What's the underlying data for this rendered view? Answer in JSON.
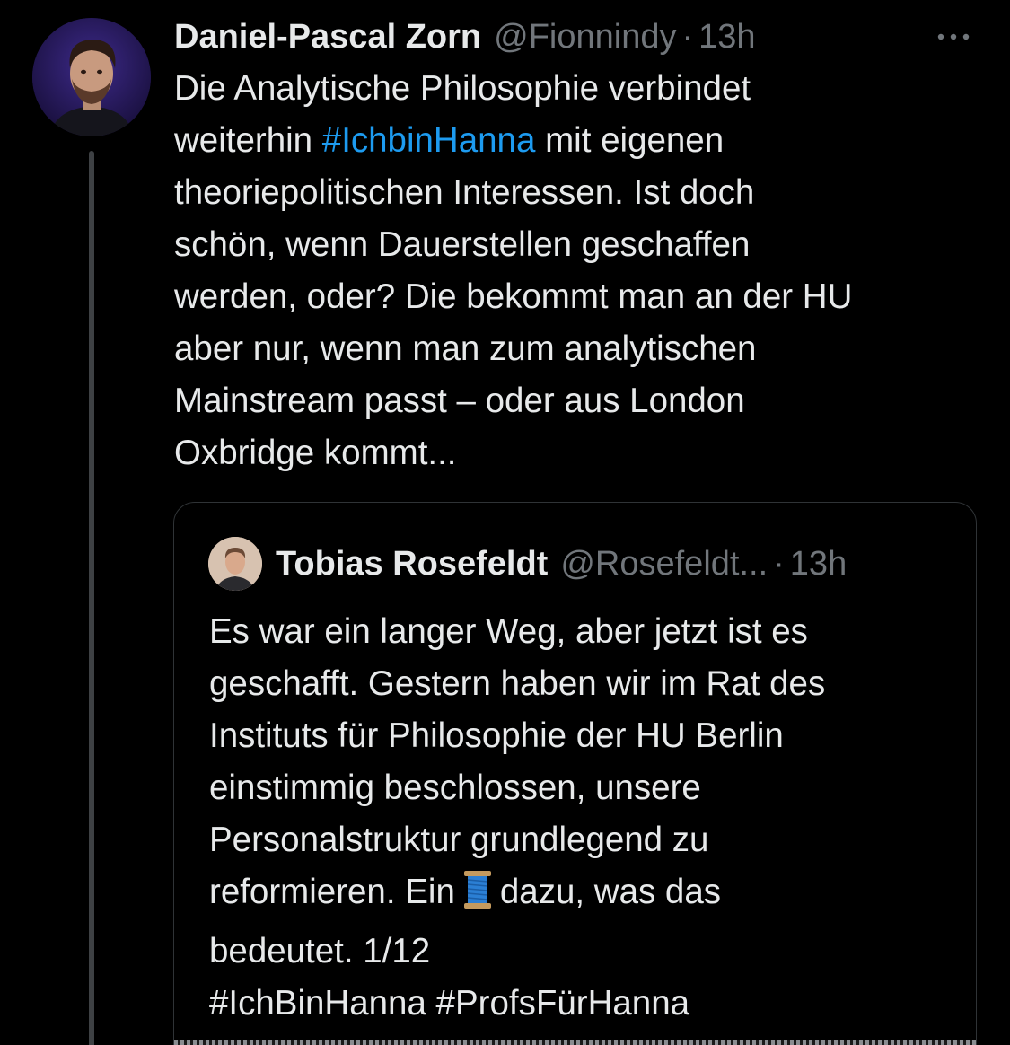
{
  "tweet": {
    "author_name": "Daniel-Pascal Zorn",
    "author_handle": "@Fionnindy",
    "separator": "·",
    "time": "13h",
    "more_icon": "more-horizontal-icon",
    "text_lines": [
      "Die Analytische Philosophie verbindet",
      "weiterhin ",
      " mit eigenen",
      "theoriepolitischen Interessen. Ist doch",
      "schön, wenn Dauerstellen geschaffen",
      "werden, oder? Die bekommt man an der HU",
      "aber nur, wenn man zum analytischen",
      "Mainstream passt – oder aus London",
      "Oxbridge kommt..."
    ],
    "hashtag": "#IchbinHanna"
  },
  "quote": {
    "author_name": "Tobias Rosefeldt",
    "author_handle": "@Rosefeldt...",
    "separator": "·",
    "time": "13h",
    "text_lines": [
      "Es war ein langer Weg, aber jetzt ist es",
      "geschafft. Gestern haben wir im Rat des",
      "Instituts für Philosophie der HU Berlin",
      "einstimmig beschlossen, unsere",
      "Personalstruktur grundlegend zu",
      "reformieren. Ein",
      "dazu, was das",
      "bedeutet. 1/12"
    ],
    "thread_icon": "thread-spool-emoji",
    "hashtags": "#IchBinHanna #ProfsFürHanna"
  },
  "colors": {
    "background": "#000000",
    "text": "#e7e9ea",
    "secondary": "#71767b",
    "link": "#1d9bf0",
    "border": "#2f3336"
  }
}
